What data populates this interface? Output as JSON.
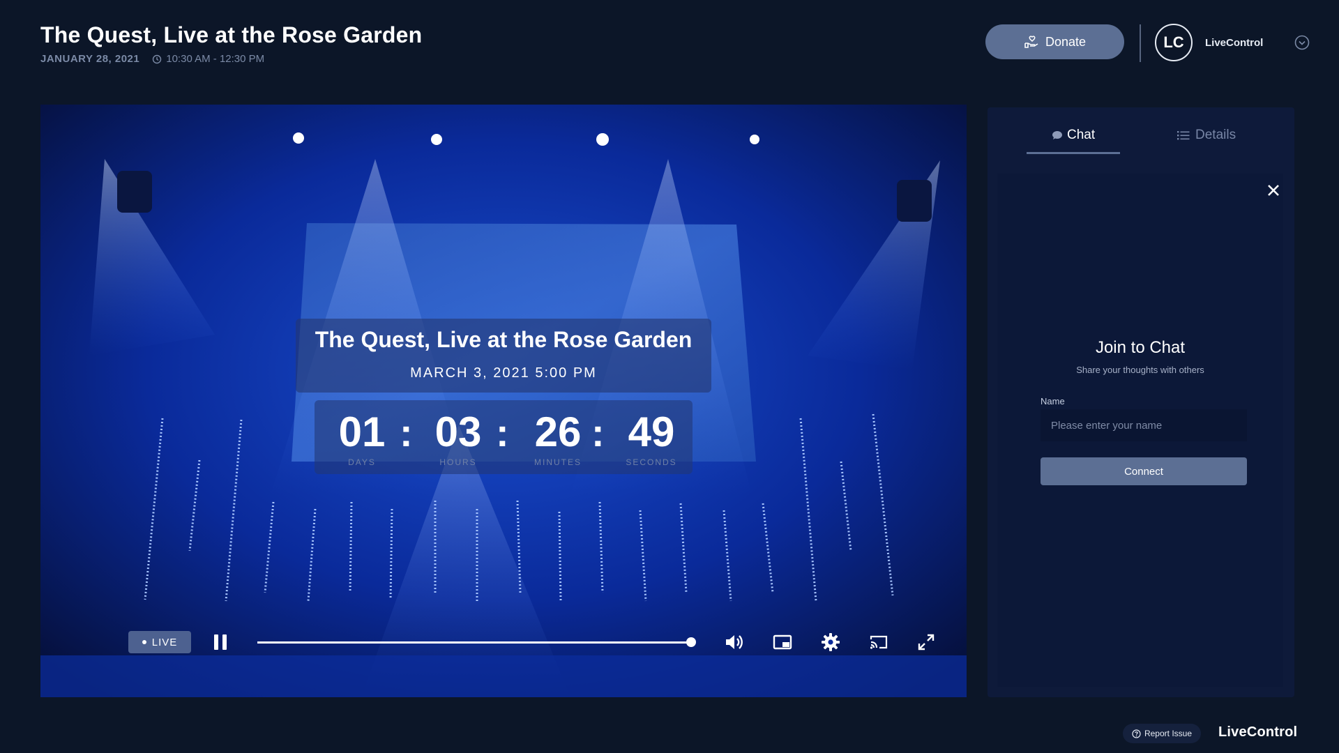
{
  "header": {
    "title": "The Quest, Live at the Rose Garden",
    "date": "JANUARY 28, 2021",
    "time": "10:30 AM - 12:30 PM",
    "donate_label": "Donate",
    "avatar_initials": "LC",
    "org_name": "LiveControl"
  },
  "player": {
    "event_title": "The Quest, Live at the Rose Garden",
    "event_datetime": "MARCH 3, 2021  5:00 PM",
    "countdown": [
      {
        "value": "01",
        "label": "DAYS"
      },
      {
        "value": "03",
        "label": "HOURS"
      },
      {
        "value": "26",
        "label": "MINUTES"
      },
      {
        "value": "49",
        "label": "SECONDS"
      }
    ],
    "separator": ":",
    "live_label": "LIVE",
    "progress_fraction": 1.0
  },
  "side_panel": {
    "tabs": [
      {
        "label": "Chat",
        "active": true
      },
      {
        "label": "Details",
        "active": false
      }
    ],
    "join_title": "Join to Chat",
    "join_subtitle": "Share your thoughts with others",
    "name_label": "Name",
    "name_placeholder": "Please enter your name",
    "connect_label": "Connect"
  },
  "footer": {
    "report_label": "Report Issue",
    "brand": "LiveControl"
  },
  "colors": {
    "background": "#0c1628",
    "accent": "#5c6f94",
    "stage_blue": "#0a2a9a"
  }
}
